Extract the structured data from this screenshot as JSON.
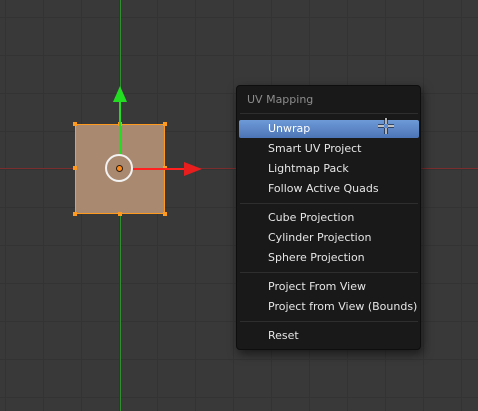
{
  "menu": {
    "title": "UV Mapping",
    "items": [
      {
        "label": "Unwrap",
        "active": true
      },
      {
        "label": "Smart UV Project"
      },
      {
        "label": "Lightmap Pack"
      },
      {
        "label": "Follow Active Quads"
      },
      {
        "label": "Cube Projection"
      },
      {
        "label": "Cylinder Projection"
      },
      {
        "label": "Sphere Projection"
      },
      {
        "label": "Project From View"
      },
      {
        "label": "Project from View (Bounds)"
      },
      {
        "label": "Reset"
      }
    ]
  },
  "colors": {
    "background": "#393939",
    "uv_face": "#a98a70",
    "selection": "#ff9a1e",
    "x_axis": "#e81e1e",
    "y_axis": "#22dd22",
    "menu_highlight": "#5a86c8"
  },
  "icons": [
    "move-manipulator-icon",
    "crosshair-cursor-icon"
  ]
}
